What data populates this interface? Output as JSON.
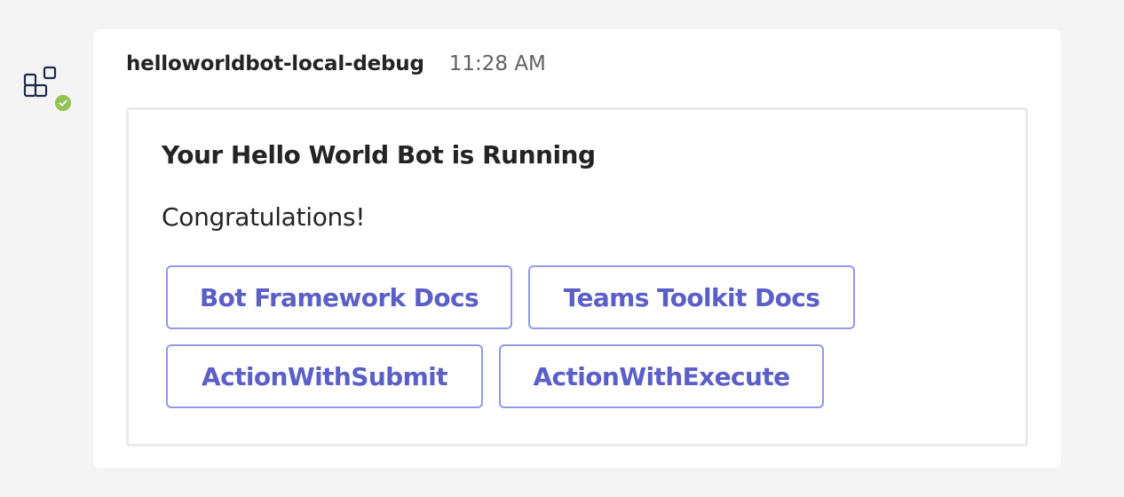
{
  "bot": {
    "icon": "apps-icon",
    "status": "available",
    "status_color": "#92c353"
  },
  "message": {
    "sender": "helloworldbot-local-debug",
    "timestamp": "11:28 AM"
  },
  "card": {
    "title": "Your Hello World Bot is Running",
    "body": "Congratulations!",
    "actions": [
      {
        "label": "Bot Framework Docs"
      },
      {
        "label": "Teams Toolkit Docs"
      },
      {
        "label": "ActionWithSubmit"
      },
      {
        "label": "ActionWithExecute"
      }
    ]
  },
  "colors": {
    "background": "#f4f4f5",
    "surface": "#ffffff",
    "accent": "#5b5fc7",
    "action_border": "#9498e9",
    "text": "#242424",
    "muted_text": "#616161"
  }
}
